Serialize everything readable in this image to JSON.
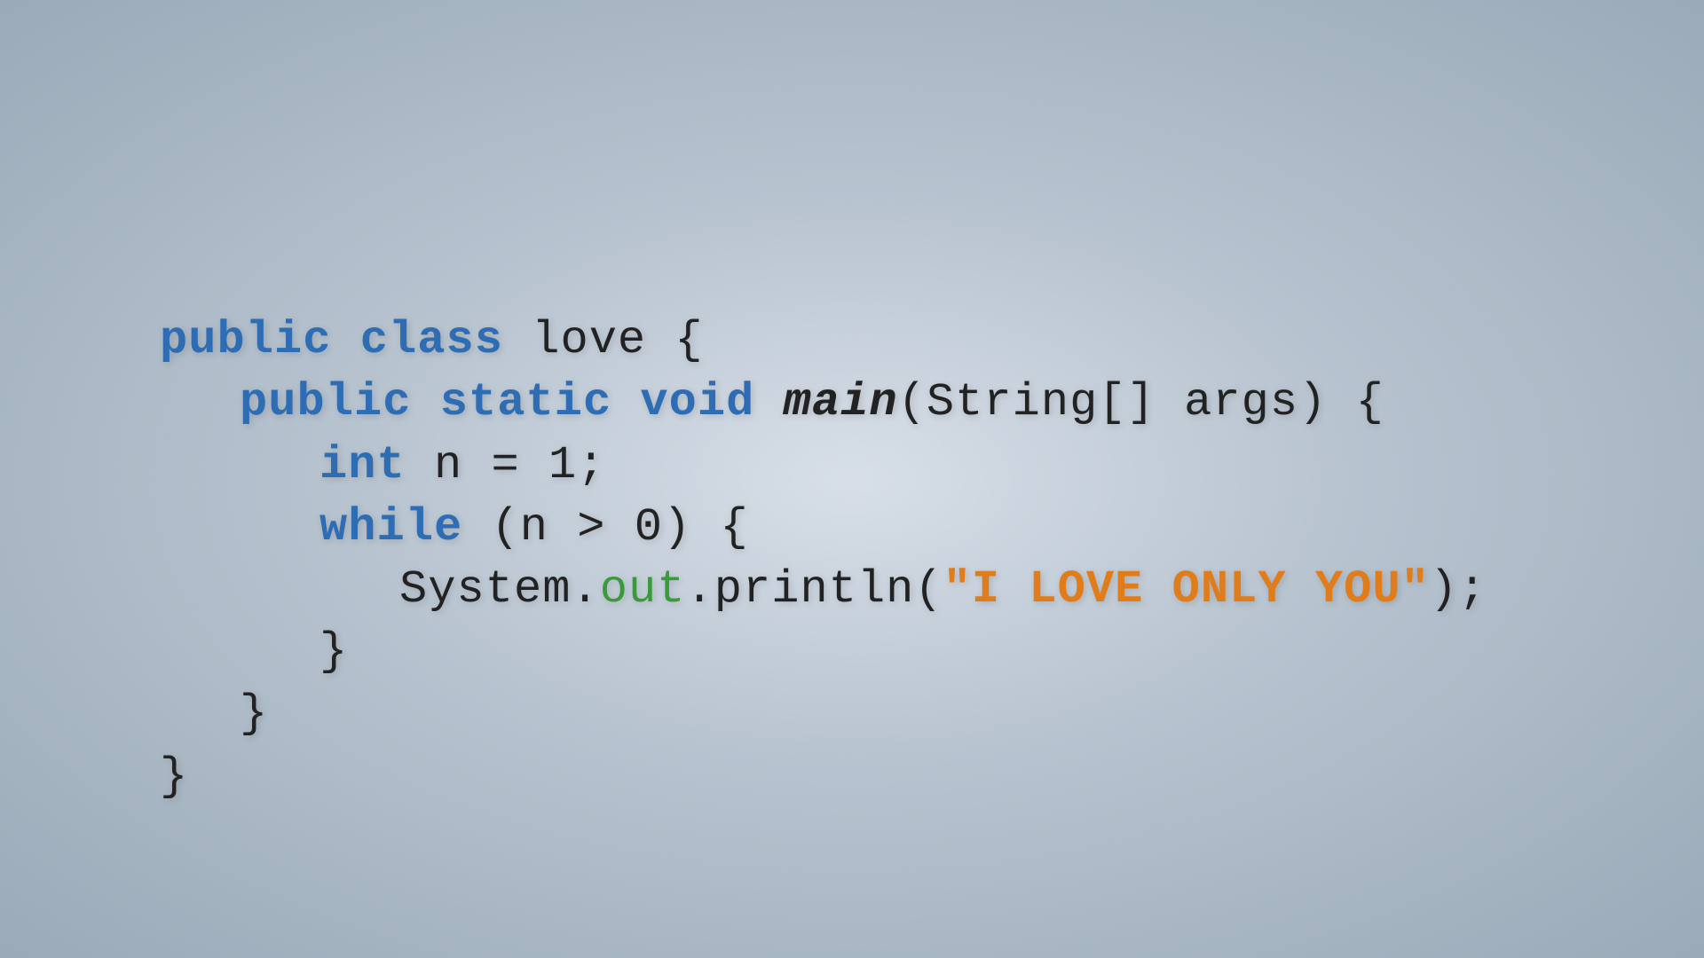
{
  "background": {
    "color_center": "#d8dfe8",
    "color_edge": "#9aaab8"
  },
  "code": {
    "line1_kw": "public class",
    "line1_name": " love {",
    "line2_kw": "public static void ",
    "line2_method": "main",
    "line2_params": "(String[] args) {",
    "line3_kw": "int",
    "line3_rest": " n = 1;",
    "line4_kw": "while",
    "line4_rest": " (n > 0) {",
    "line5_sys": "System.",
    "line5_out": "out",
    "line5_print": ".println(",
    "line5_string": "\"I LOVE ONLY YOU\"",
    "line5_end": ");",
    "line6": "}",
    "line7": "}",
    "line8": "}"
  }
}
